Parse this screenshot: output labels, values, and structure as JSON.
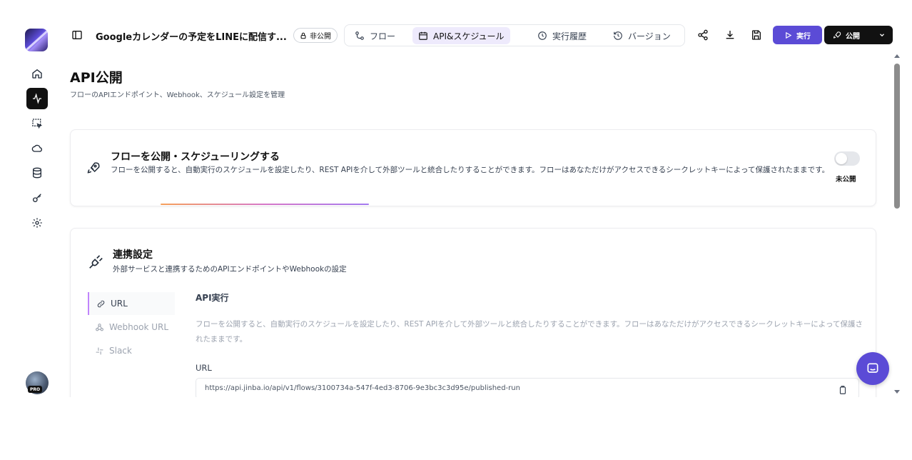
{
  "header": {
    "flow_title": "Googleカレンダーの予定をLINEに配信す...",
    "private_badge": "非公開",
    "tabs": [
      {
        "label": "フロー",
        "icon": "flow-icon"
      },
      {
        "label": "API&スケジュール",
        "icon": "calendar-icon"
      },
      {
        "label": "実行履歴",
        "icon": "clock-icon"
      },
      {
        "label": "バージョン",
        "icon": "history-icon"
      }
    ],
    "run_label": "実行",
    "publish_label": "公開"
  },
  "page": {
    "title": "API公開",
    "subtitle": "フローのAPIエンドポイント、Webhook、スケジュール設定を管理"
  },
  "publish_card": {
    "title": "フローを公開・スケジューリングする",
    "description": "フローを公開すると、自動実行のスケジュールを設定したり、REST APIを介して外部ツールと統合したりすることができます。フローはあなただけがアクセスできるシークレットキーによって保護されたままです。",
    "toggle_label": "未公開",
    "published": false
  },
  "integration_card": {
    "title": "連携設定",
    "subtitle": "外部サービスと連携するためのAPIエンドポイントやWebhookの設定",
    "nav": [
      {
        "label": "URL",
        "icon": "link-icon",
        "active": true
      },
      {
        "label": "Webhook URL",
        "icon": "webhook-icon",
        "active": false
      },
      {
        "label": "Slack",
        "icon": "slack-icon",
        "active": false
      }
    ],
    "section_title": "API実行",
    "section_desc": "フローを公開すると、自動実行のスケジュールを設定したり、REST APIを介して外部ツールと統合したりすることができます。フローはあなただけがアクセスできるシークレットキーによって保護されたままです。",
    "url_label": "URL",
    "url_value": "https://api.jinba.io/api/v1/flows/3100734a-547f-4ed3-8706-9e3bc3c3d95e/published-run"
  },
  "user": {
    "badge": "PRO"
  },
  "colors": {
    "accent": "#5b4bd6",
    "active_tab_bg": "#eeeafc"
  }
}
